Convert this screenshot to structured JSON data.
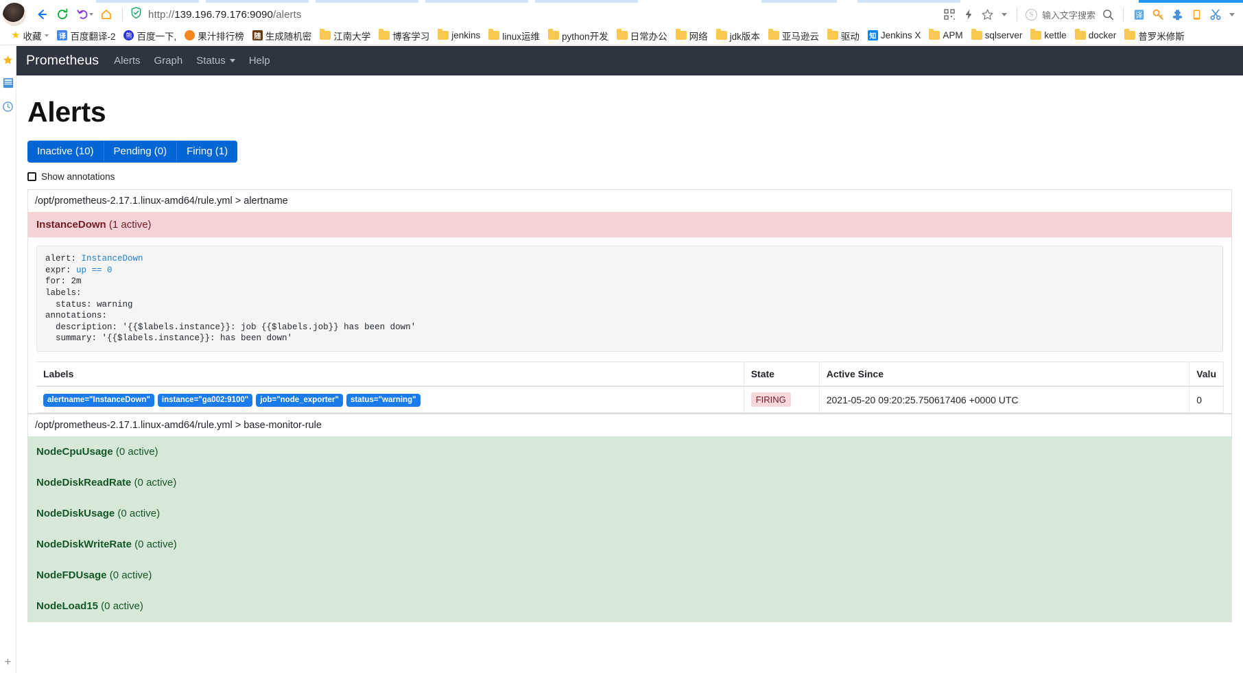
{
  "browser": {
    "url_scheme": "http://",
    "url_main": "139.196.79.176:9090",
    "url_path": "/alerts",
    "search_placeholder": "输入文字搜索",
    "nav": {
      "back": "back-arrow",
      "reload": "reload",
      "undo": "undo",
      "home": "home",
      "shield": "security-shield"
    },
    "bookmarks": [
      {
        "label": "收藏",
        "icon": "star",
        "color": "#fcc21b",
        "type": "star",
        "caret": true
      },
      {
        "label": "百度翻译-2",
        "icon": "译",
        "color": "#4285f4",
        "type": "square"
      },
      {
        "label": "百度一下,",
        "icon": "baidu-paw",
        "color": "#2932e1",
        "type": "paw"
      },
      {
        "label": "果汁排行榜",
        "icon": "juice",
        "color": "#f5861f",
        "type": "circle"
      },
      {
        "label": "生成随机密",
        "icon": "随",
        "color": "#6a3b10",
        "type": "square"
      },
      {
        "label": "江南大学",
        "icon": "folder",
        "type": "folder"
      },
      {
        "label": "博客学习",
        "icon": "folder",
        "type": "folder"
      },
      {
        "label": "jenkins",
        "icon": "folder",
        "type": "folder"
      },
      {
        "label": "linux运维",
        "icon": "folder",
        "type": "folder"
      },
      {
        "label": "python开发",
        "icon": "folder",
        "type": "folder"
      },
      {
        "label": "日常办公",
        "icon": "folder",
        "type": "folder"
      },
      {
        "label": "网络",
        "icon": "folder",
        "type": "folder"
      },
      {
        "label": "jdk版本",
        "icon": "folder",
        "type": "folder"
      },
      {
        "label": "亚马逊云",
        "icon": "folder",
        "type": "folder"
      },
      {
        "label": "驱动",
        "icon": "folder",
        "type": "folder"
      },
      {
        "label": "Jenkins X",
        "icon": "知",
        "color": "#0084ff",
        "type": "square"
      },
      {
        "label": "APM",
        "icon": "folder",
        "type": "folder"
      },
      {
        "label": "sqlserver",
        "icon": "folder",
        "type": "folder"
      },
      {
        "label": "kettle",
        "icon": "folder",
        "type": "folder"
      },
      {
        "label": "docker",
        "icon": "folder",
        "type": "folder"
      },
      {
        "label": "普罗米修斯",
        "icon": "folder",
        "type": "folder"
      }
    ]
  },
  "navbar": {
    "brand": "Prometheus",
    "links": [
      {
        "label": "Alerts",
        "dropdown": false
      },
      {
        "label": "Graph",
        "dropdown": false
      },
      {
        "label": "Status",
        "dropdown": true
      },
      {
        "label": "Help",
        "dropdown": false
      }
    ]
  },
  "page": {
    "title": "Alerts",
    "tabs": [
      {
        "label": "Inactive (10)"
      },
      {
        "label": "Pending (0)"
      },
      {
        "label": "Firing (1)"
      }
    ],
    "show_annotations_label": "Show annotations",
    "show_annotations_checked": false
  },
  "groups": [
    {
      "header": "/opt/prometheus-2.17.1.linux-amd64/rule.yml > alertname",
      "rules": [
        {
          "name": "InstanceDown",
          "count": "(1 active)",
          "state": "firing",
          "code_lines": [
            {
              "text": "alert: ",
              "value": "InstanceDown"
            },
            {
              "text": "expr: ",
              "value": "up == 0"
            },
            {
              "text": "for: 2m",
              "value": ""
            },
            {
              "text": "labels:",
              "value": ""
            },
            {
              "text": "  status: warning",
              "value": ""
            },
            {
              "text": "annotations:",
              "value": ""
            },
            {
              "text": "  description: '{{$labels.instance}}: job {{$labels.job}} has been down'",
              "value": ""
            },
            {
              "text": "  summary: '{{$labels.instance}}: has been down'",
              "value": ""
            }
          ],
          "table": {
            "columns": [
              "Labels",
              "State",
              "Active Since",
              "Valu"
            ],
            "rows": [
              {
                "labels": [
                  "alertname=\"InstanceDown\"",
                  "instance=\"ga002:9100\"",
                  "job=\"node_exporter\"",
                  "status=\"warning\""
                ],
                "state": "FIRING",
                "active_since": "2021-05-20 09:20:25.750617406 +0000 UTC",
                "value": "0"
              }
            ]
          }
        }
      ]
    },
    {
      "header": "/opt/prometheus-2.17.1.linux-amd64/rule.yml > base-monitor-rule",
      "rules": [
        {
          "name": "NodeCpuUsage",
          "count": "(0 active)",
          "state": "inactive"
        },
        {
          "name": "NodeDiskReadRate",
          "count": "(0 active)",
          "state": "inactive"
        },
        {
          "name": "NodeDiskUsage",
          "count": "(0 active)",
          "state": "inactive"
        },
        {
          "name": "NodeDiskWriteRate",
          "count": "(0 active)",
          "state": "inactive"
        },
        {
          "name": "NodeFDUsage",
          "count": "(0 active)",
          "state": "inactive"
        },
        {
          "name": "NodeLoad15",
          "count": "(0 active)",
          "state": "inactive"
        }
      ]
    }
  ],
  "colors": {
    "navbar_bg": "#2e3440",
    "tab_active": "#0366d6",
    "firing_bg": "#f5d3d6",
    "inactive_bg": "#d6e9d8",
    "label_badge": "#1a7ceb"
  }
}
